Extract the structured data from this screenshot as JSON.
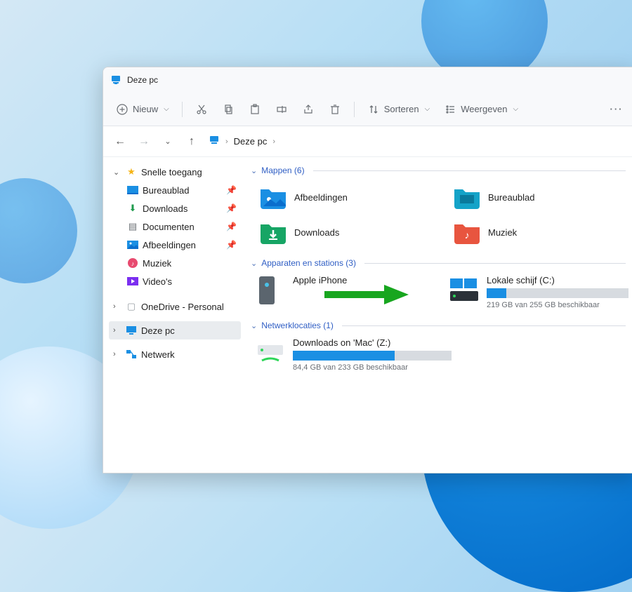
{
  "window": {
    "title": "Deze pc"
  },
  "toolbar": {
    "new_label": "Nieuw",
    "sort_label": "Sorteren",
    "view_label": "Weergeven"
  },
  "breadcrumb": {
    "label": "Deze pc"
  },
  "sidebar": {
    "quick_access": "Snelle toegang",
    "desktop": "Bureaublad",
    "downloads": "Downloads",
    "documents": "Documenten",
    "pictures": "Afbeeldingen",
    "music": "Muziek",
    "videos": "Video's",
    "onedrive": "OneDrive - Personal",
    "this_pc": "Deze pc",
    "network": "Netwerk"
  },
  "sections": {
    "folders": "Mappen (6)",
    "devices": "Apparaten en stations (3)",
    "network": "Netwerklocaties (1)"
  },
  "folders": {
    "pictures": "Afbeeldingen",
    "desktop": "Bureaublad",
    "downloads": "Downloads",
    "music": "Muziek"
  },
  "devices": {
    "iphone": {
      "name": "Apple iPhone"
    },
    "local": {
      "name": "Lokale schijf (C:)",
      "sub": "219 GB van 255 GB beschikbaar",
      "fill_percent": 14
    }
  },
  "network_loc": {
    "name": "Downloads on 'Mac' (Z:)",
    "sub": "84,4 GB van 233 GB beschikbaar",
    "fill_percent": 64
  }
}
